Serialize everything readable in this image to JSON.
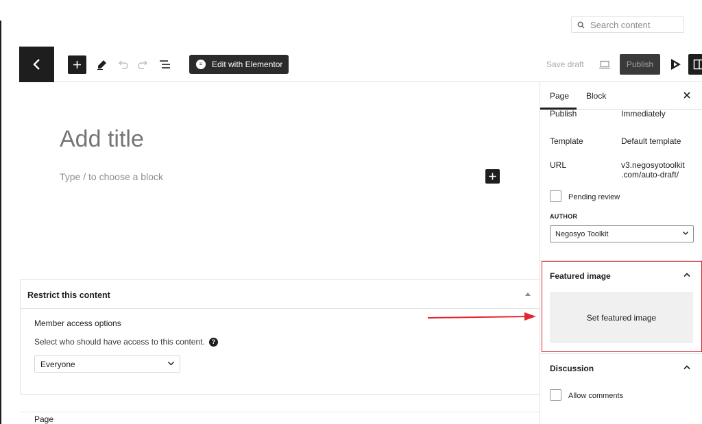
{
  "search": {
    "placeholder": "Search content"
  },
  "toolbar": {
    "elementor_label": "Edit with Elementor",
    "save_draft_label": "Save draft",
    "publish_label": "Publish"
  },
  "editor": {
    "title_placeholder": "Add title",
    "block_placeholder": "Type / to choose a block"
  },
  "restrict": {
    "title": "Restrict this content",
    "member_label": "Member access options",
    "member_desc": "Select who should have access to this content.",
    "help_glyph": "?",
    "selected": "Everyone"
  },
  "footer": {
    "breadcrumb": "Page"
  },
  "sidebar": {
    "tabs": [
      {
        "label": "Page",
        "active": true
      },
      {
        "label": "Block",
        "active": false
      }
    ],
    "publish": {
      "label": "Publish",
      "value": "Immediately"
    },
    "template": {
      "label": "Template",
      "value": "Default template"
    },
    "url": {
      "label": "URL",
      "value_line1": "v3.negosyotoolkit",
      "value_line2": ".com/auto-draft/"
    },
    "pending_review": "Pending review",
    "author": {
      "label": "AUTHOR",
      "selected": "Negosyo Toolkit"
    },
    "featured": {
      "title": "Featured image",
      "button": "Set featured image"
    },
    "discussion": {
      "title": "Discussion",
      "allow_comments": "Allow comments"
    }
  },
  "colors": {
    "dark": "#1e1e1e",
    "highlight_red": "#d4242b",
    "arrow_red": "#e3262b"
  }
}
